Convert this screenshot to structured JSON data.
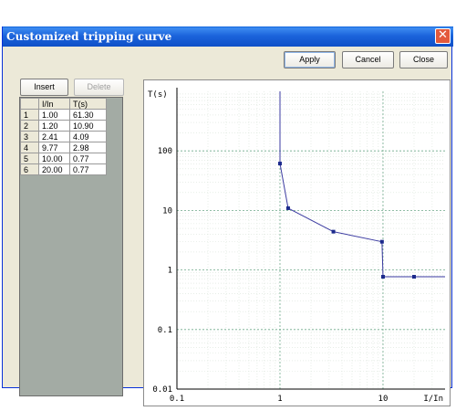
{
  "window": {
    "title": "Customized tripping curve",
    "close_glyph": "✕"
  },
  "toolbar": {
    "apply_label": "Apply",
    "cancel_label": "Cancel",
    "close_label": "Close"
  },
  "table_panel": {
    "insert_label": "Insert",
    "delete_label": "Delete",
    "columns": [
      "I/In",
      "T(s)"
    ],
    "rows": [
      {
        "index": "1",
        "i_in": "1.00",
        "t": "61.30"
      },
      {
        "index": "2",
        "i_in": "1.20",
        "t": "10.90"
      },
      {
        "index": "3",
        "i_in": "2.41",
        "t": "4.09"
      },
      {
        "index": "4",
        "i_in": "9.77",
        "t": "2.98"
      },
      {
        "index": "5",
        "i_in": "10.00",
        "t": "0.77"
      },
      {
        "index": "6",
        "i_in": "20.00",
        "t": "0.77"
      }
    ]
  },
  "chart_data": {
    "type": "line",
    "ylabel": "T(s)",
    "xlabel": "I/In",
    "xscale": "log",
    "yscale": "log",
    "xlim": [
      0.1,
      40
    ],
    "ylim": [
      0.01,
      1000
    ],
    "x_ticks": [
      {
        "value": 0.1,
        "label": "0.1"
      },
      {
        "value": 1,
        "label": "1"
      },
      {
        "value": 10,
        "label": "10"
      }
    ],
    "y_ticks": [
      {
        "value": 0.01,
        "label": "0.01"
      },
      {
        "value": 0.1,
        "label": "0.1"
      },
      {
        "value": 1,
        "label": "1"
      },
      {
        "value": 10,
        "label": "10"
      },
      {
        "value": 100,
        "label": "100"
      }
    ],
    "grid": true,
    "line_color": "#3a3aa0",
    "points": [
      {
        "x": 1.0,
        "y": 61.3
      },
      {
        "x": 1.2,
        "y": 10.9
      },
      {
        "x": 3.3,
        "y": 4.4
      },
      {
        "x": 9.77,
        "y": 2.98
      },
      {
        "x": 10.0,
        "y": 0.77
      },
      {
        "x": 20.0,
        "y": 0.77
      }
    ],
    "asymptote_x": 1.0,
    "tail_x": 40
  }
}
